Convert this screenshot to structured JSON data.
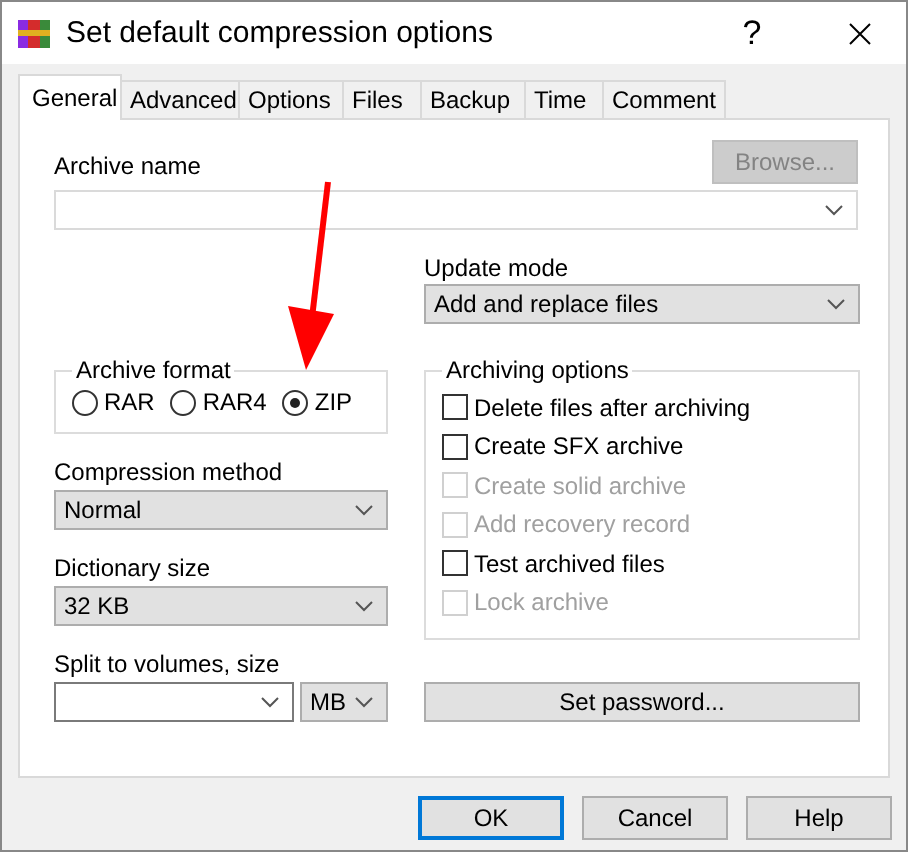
{
  "window": {
    "title": "Set default compression options",
    "help": "?"
  },
  "tabs": [
    {
      "label": "General",
      "selected": true
    },
    {
      "label": "Advanced",
      "selected": false
    },
    {
      "label": "Options",
      "selected": false
    },
    {
      "label": "Files",
      "selected": false
    },
    {
      "label": "Backup",
      "selected": false
    },
    {
      "label": "Time",
      "selected": false
    },
    {
      "label": "Comment",
      "selected": false
    }
  ],
  "archive_name": {
    "label": "Archive name"
  },
  "browse_button": {
    "label": "Browse...",
    "disabled": true
  },
  "update_mode": {
    "label": "Update mode",
    "value": "Add and replace files"
  },
  "archive_format": {
    "label": "Archive format",
    "options": [
      {
        "label": "RAR",
        "selected": false
      },
      {
        "label": "RAR4",
        "selected": false
      },
      {
        "label": "ZIP",
        "selected": true
      }
    ]
  },
  "compression_method": {
    "label": "Compression method",
    "value": "Normal"
  },
  "dictionary_size": {
    "label": "Dictionary size",
    "value": "32 KB"
  },
  "split_volumes": {
    "label": "Split to volumes, size",
    "unit": "MB"
  },
  "archiving_options": {
    "label": "Archiving options",
    "items": [
      {
        "label": "Delete files after archiving",
        "checked": false,
        "disabled": false
      },
      {
        "label": "Create SFX archive",
        "checked": false,
        "disabled": false
      },
      {
        "label": "Create solid archive",
        "checked": false,
        "disabled": true
      },
      {
        "label": "Add recovery record",
        "checked": false,
        "disabled": true
      },
      {
        "label": "Test archived files",
        "checked": false,
        "disabled": false
      },
      {
        "label": "Lock archive",
        "checked": false,
        "disabled": true
      }
    ]
  },
  "set_password_button": {
    "label": "Set password..."
  },
  "buttons": [
    {
      "label": "OK",
      "default": true
    },
    {
      "label": "Cancel",
      "default": false
    },
    {
      "label": "Help",
      "default": false
    }
  ]
}
